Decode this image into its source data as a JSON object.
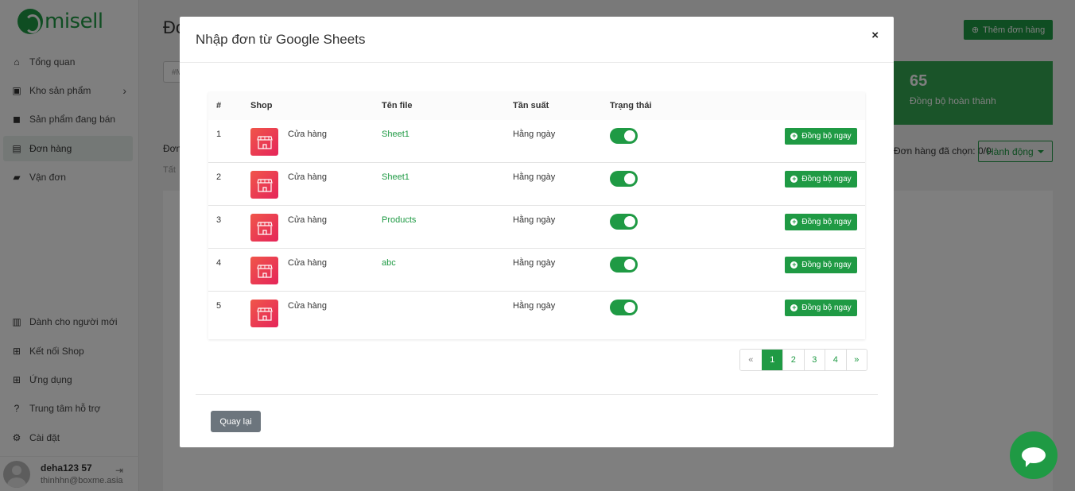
{
  "app": {
    "logo_text": "misell"
  },
  "sidebar": {
    "items": [
      {
        "label": "Tổng quan",
        "icon": "home-icon"
      },
      {
        "label": "Kho sản phẩm",
        "icon": "box-icon"
      },
      {
        "label": "Sản phẩm đang bán",
        "icon": "bag-icon"
      },
      {
        "label": "Đơn hàng",
        "icon": "orders-icon",
        "active": true
      },
      {
        "label": "Vận đơn",
        "icon": "truck-icon"
      },
      {
        "label": "Dành cho người mới",
        "icon": "book-icon"
      },
      {
        "label": "Kết nối Shop",
        "icon": "cart-icon"
      },
      {
        "label": "Ứng dụng",
        "icon": "apps-icon"
      },
      {
        "label": "Trung tâm hỗ trợ",
        "icon": "help-icon"
      },
      {
        "label": "Cài đặt",
        "icon": "gear-icon"
      }
    ],
    "user": {
      "name": "deha123 57",
      "email": "thinhhn@boxme.asia"
    }
  },
  "main": {
    "title": "Đơ",
    "add_button": "Thêm đơn hàng",
    "search_placeholder": "#M",
    "stat": {
      "value": "65",
      "label": "Đồng bộ hoàn thành"
    },
    "orders_header": "Đơn",
    "orders_sub": "Tất",
    "selected_info": "Đơn hàng đã chọn: 0/0",
    "action_dropdown": "Hành động"
  },
  "modal": {
    "title": "Nhập đơn từ Google Sheets",
    "close": "×",
    "columns": [
      "#",
      "Shop",
      "Tên file",
      "Tần suất",
      "Trạng thái"
    ],
    "rows": [
      {
        "num": "1",
        "shop": "Cửa hàng",
        "file": "Sheet1",
        "freq": "Hằng ngày",
        "enabled": true,
        "action": "Đồng bộ ngay"
      },
      {
        "num": "2",
        "shop": "Cửa hàng",
        "file": "Sheet1",
        "freq": "Hằng ngày",
        "enabled": true,
        "action": "Đồng bộ ngay"
      },
      {
        "num": "3",
        "shop": "Cửa hàng",
        "file": "Products",
        "freq": "Hằng ngày",
        "enabled": true,
        "action": "Đồng bộ ngay"
      },
      {
        "num": "4",
        "shop": "Cửa hàng",
        "file": "abc",
        "freq": "Hằng ngày",
        "enabled": true,
        "action": "Đồng bộ ngay"
      },
      {
        "num": "5",
        "shop": "Cửa hàng",
        "file": "",
        "freq": "Hằng ngày",
        "enabled": true,
        "action": "Đồng bộ ngay"
      }
    ],
    "pagination": {
      "prev": "«",
      "pages": [
        "1",
        "2",
        "3",
        "4"
      ],
      "current": "1",
      "next": "»"
    },
    "back_button": "Quay lại"
  },
  "colors": {
    "brand": "#1f9a44",
    "shop_gradient": [
      "#f0564a",
      "#e5255a"
    ]
  }
}
